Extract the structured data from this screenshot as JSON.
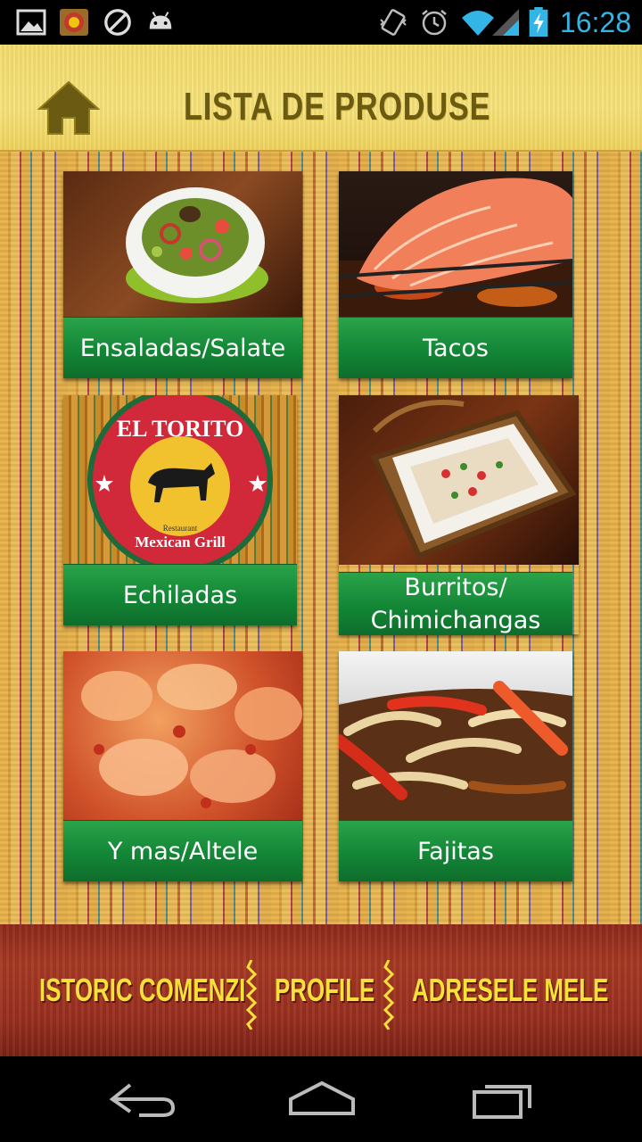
{
  "status_bar": {
    "time": "16:28",
    "icons": [
      "gallery-icon",
      "app-logo-icon",
      "blocked-icon",
      "android-icon",
      "vibrate-icon",
      "alarm-icon",
      "wifi-icon",
      "signal-icon",
      "battery-charging-icon"
    ],
    "accent_color": "#33b5e5"
  },
  "header": {
    "title": "LISTA DE PRODUSE",
    "home_icon": "home-icon"
  },
  "products": [
    {
      "label": "Ensaladas/Salate"
    },
    {
      "label": "Tacos"
    },
    {
      "label": "Echiladas"
    },
    {
      "label": "Burritos/\nChimichangas"
    },
    {
      "label": "Y mas/Altele"
    },
    {
      "label": "Fajitas"
    }
  ],
  "logo": {
    "line1": "EL TORITO",
    "line2": "Mexican Grill",
    "line3": "Restaurant"
  },
  "footer_nav": {
    "history": "ISTORIC COMENZI",
    "profile": "PROFILE",
    "addresses": "ADRESELE MELE"
  },
  "system_nav": [
    "back-icon",
    "home-outline-icon",
    "recent-apps-icon"
  ],
  "colors": {
    "tile_band": "#138636",
    "header": "#f6e27a",
    "footer": "#a73a24",
    "nav_text": "#f6e03a"
  }
}
